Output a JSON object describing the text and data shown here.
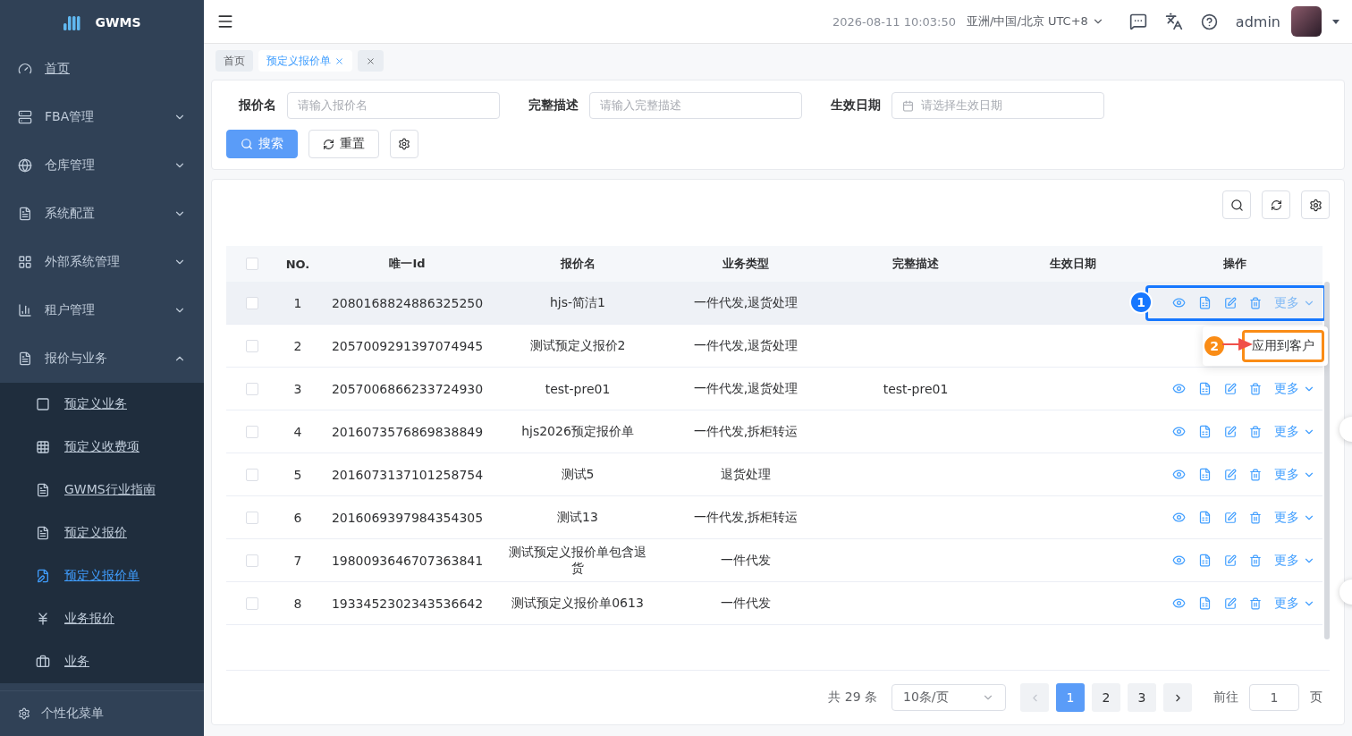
{
  "app": {
    "name": "GWMS"
  },
  "sidebar": {
    "items": [
      {
        "label": "首页",
        "selected": false
      },
      {
        "label": "FBA管理",
        "expanded": false,
        "selected": false
      },
      {
        "label": "仓库管理",
        "expanded": false,
        "selected": false
      },
      {
        "label": "系统配置",
        "expanded": false,
        "selected": false
      },
      {
        "label": "外部系统管理",
        "expanded": false,
        "selected": false
      },
      {
        "label": "租户管理",
        "expanded": false,
        "selected": false
      },
      {
        "label": "报价与业务",
        "expanded": true,
        "selected": false,
        "children": [
          {
            "label": "预定义业务",
            "selected": false
          },
          {
            "label": "预定义收费项",
            "selected": false
          },
          {
            "label": "GWMS行业指南",
            "selected": false
          },
          {
            "label": "预定义报价",
            "selected": false
          },
          {
            "label": "预定义报价单",
            "selected": true
          },
          {
            "label": "业务报价",
            "selected": false
          },
          {
            "label": "业务",
            "selected": false
          }
        ]
      }
    ],
    "footer": "个性化菜单"
  },
  "header": {
    "datetime": "2026-08-11 10:03:50",
    "timezone": "亚洲/中国/北京 UTC+8",
    "user": "admin"
  },
  "tabs": [
    {
      "kind": "page",
      "label": "首页",
      "selected": false
    },
    {
      "kind": "closable",
      "label": "预定义报价单",
      "selected": true
    },
    {
      "kind": "close",
      "selected": false
    }
  ],
  "search": {
    "fields": [
      {
        "label": "报价名",
        "placeholder": "请输入报价名",
        "kind": "text"
      },
      {
        "label": "完整描述",
        "placeholder": "请输入完整描述",
        "kind": "text"
      },
      {
        "label": "生效日期",
        "placeholder": "请选择生效日期",
        "kind": "date"
      }
    ],
    "buttons": [
      {
        "label": "搜索",
        "kind": "primary"
      },
      {
        "label": "重置",
        "kind": "reset"
      },
      {
        "kind": "settings"
      }
    ]
  },
  "table": {
    "header_checked": false,
    "columns": [
      "NO.",
      "唯一Id",
      "报价名",
      "业务类型",
      "完整描述",
      "生效日期",
      "操作"
    ],
    "rows": [
      {
        "no": "1",
        "id": "2080168824886325250",
        "name": "hjs-简洁1",
        "type": "一件代发,退货处理",
        "desc": "",
        "checked": false,
        "hovered": true,
        "menu_open": true,
        "more": "更多"
      },
      {
        "no": "2",
        "id": "2057009291397074945",
        "name": "测试预定义报价2",
        "type": "一件代发,退货处理",
        "desc": "",
        "checked": false,
        "hovered": false,
        "more": ""
      },
      {
        "no": "3",
        "id": "2057006866233724930",
        "name": "test-pre01",
        "type": "一件代发,退货处理",
        "desc": "test-pre01",
        "checked": false,
        "hovered": false,
        "menu_open": false,
        "more": "更多"
      },
      {
        "no": "4",
        "id": "2016073576869838849",
        "name": "hjs2026预定报价单",
        "type": "一件代发,拆柜转运",
        "desc": "",
        "checked": false,
        "hovered": false,
        "menu_open": false,
        "more": "更多"
      },
      {
        "no": "5",
        "id": "2016073137101258754",
        "name": "测试5",
        "type": "退货处理",
        "desc": "",
        "checked": false,
        "hovered": false,
        "menu_open": false,
        "more": "更多"
      },
      {
        "no": "6",
        "id": "2016069397984354305",
        "name": "测试13",
        "type": "一件代发,拆柜转运",
        "desc": "",
        "checked": false,
        "hovered": false,
        "menu_open": false,
        "more": "更多"
      },
      {
        "no": "7",
        "id": "1980093646707363841",
        "name": "测试预定义报价单包含退货",
        "type": "一件代发",
        "desc": "",
        "checked": false,
        "hovered": false,
        "menu_open": false,
        "more": "更多"
      },
      {
        "no": "8",
        "id": "1933452302343536642",
        "name": "测试预定义报价单0613",
        "type": "一件代发",
        "desc": "",
        "checked": false,
        "hovered": false,
        "menu_open": false,
        "more": "更多"
      }
    ],
    "menu": {
      "items": [
        "应用到客户"
      ]
    },
    "callouts": [
      {
        "number": "1",
        "color": "#1677ff"
      },
      {
        "number": "2",
        "color": "#fa8c16"
      }
    ]
  },
  "pagination": {
    "total": "共 29 条",
    "page_size": "10条/页",
    "pages": [
      {
        "label": "1",
        "selected": true
      },
      {
        "label": "2",
        "selected": false
      },
      {
        "label": "3",
        "selected": false
      }
    ],
    "goto": "前往",
    "page": "1",
    "unit": "页"
  }
}
